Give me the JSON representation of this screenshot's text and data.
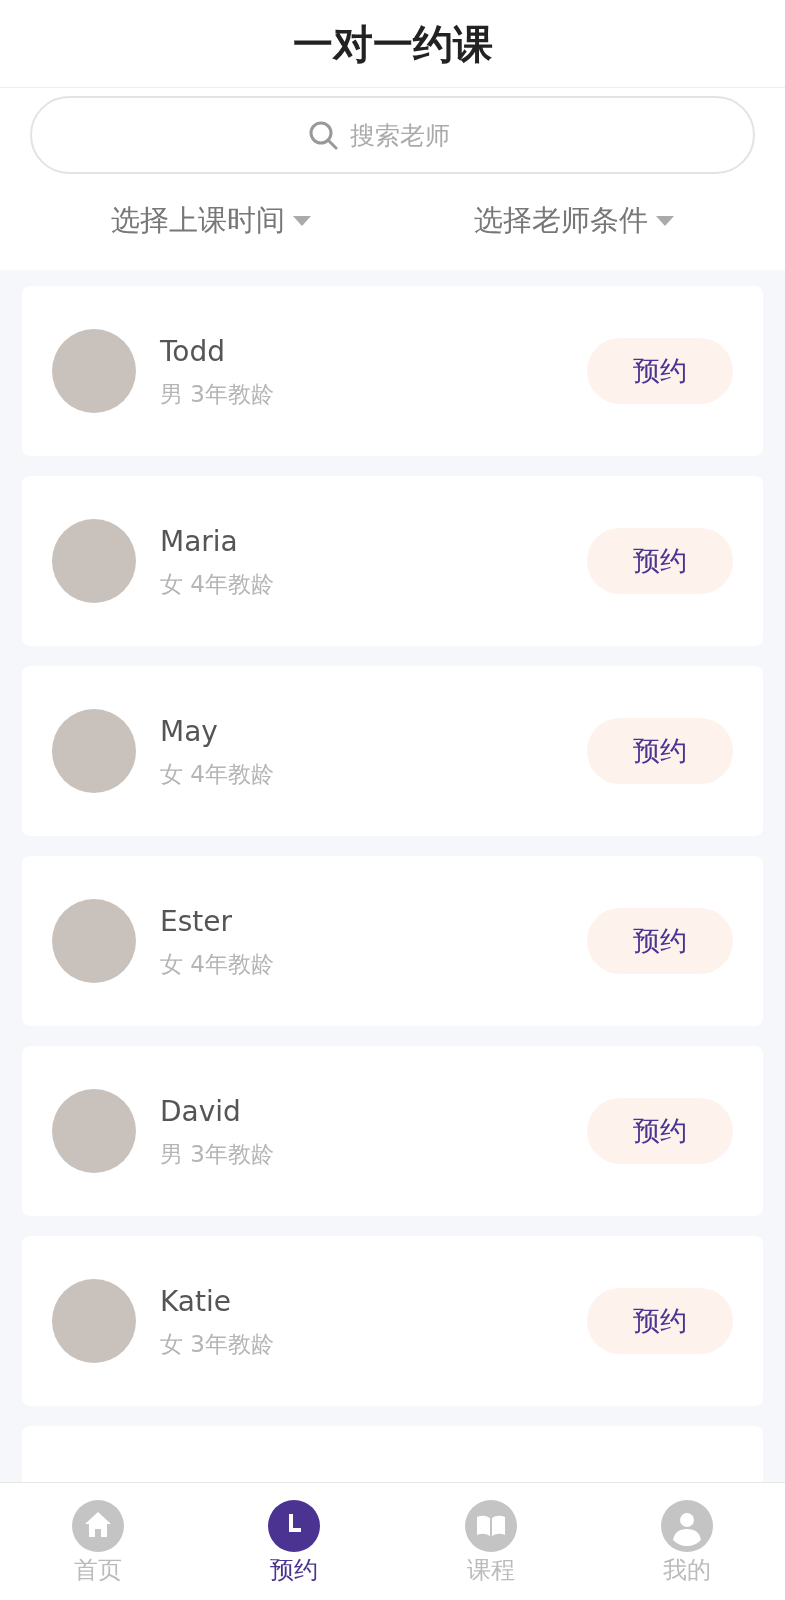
{
  "header": {
    "title": "一对一约课"
  },
  "search": {
    "placeholder": "搜索老师"
  },
  "filters": [
    {
      "label": "选择上课时间"
    },
    {
      "label": "选择老师条件"
    }
  ],
  "teachers": [
    {
      "name": "Todd",
      "info": "男 3年教龄",
      "button": "预约"
    },
    {
      "name": "Maria",
      "info": "女 4年教龄",
      "button": "预约"
    },
    {
      "name": "May",
      "info": "女 4年教龄",
      "button": "预约"
    },
    {
      "name": "Ester",
      "info": "女 4年教龄",
      "button": "预约"
    },
    {
      "name": "David",
      "info": "男 3年教龄",
      "button": "预约"
    },
    {
      "name": "Katie",
      "info": "女 3年教龄",
      "button": "预约"
    }
  ],
  "tab_bar": [
    {
      "kind": "home",
      "label": "首页",
      "selected": false
    },
    {
      "kind": "clock",
      "label": "预约",
      "selected": true
    },
    {
      "kind": "book",
      "label": "课程",
      "selected": false
    },
    {
      "kind": "user",
      "label": "我的",
      "selected": false
    }
  ]
}
